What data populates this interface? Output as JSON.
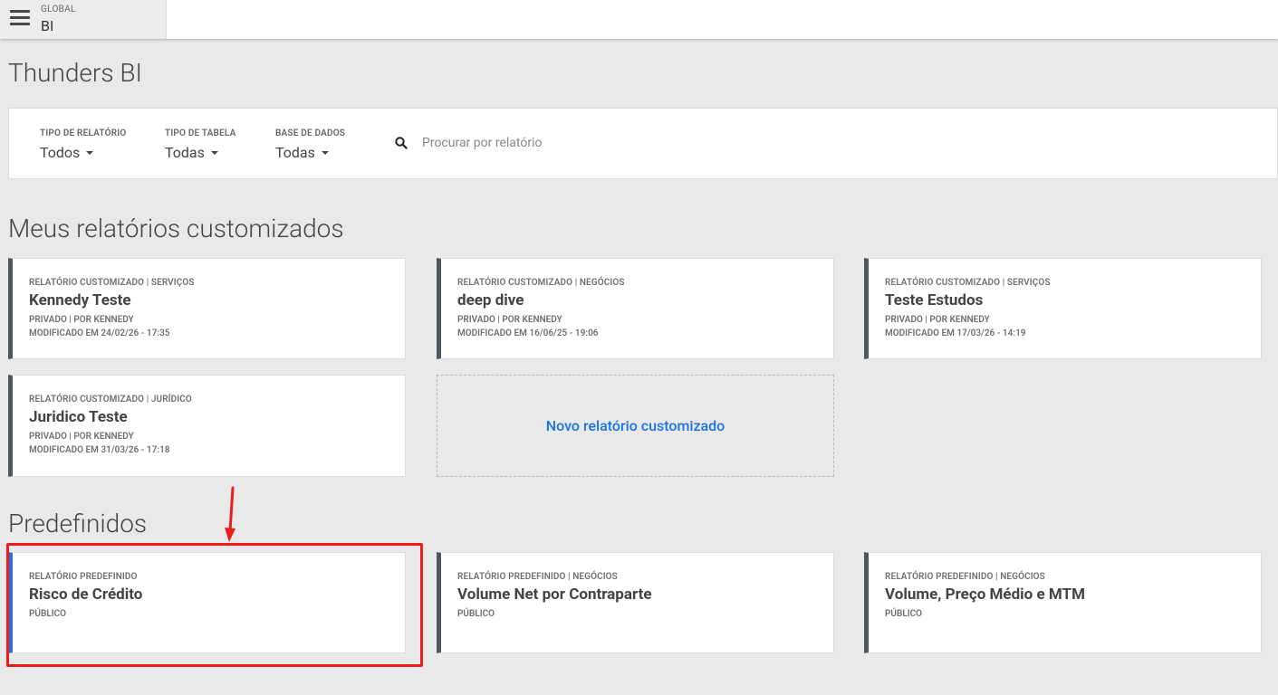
{
  "header": {
    "context_label": "GLOBAL",
    "context_value": "BI"
  },
  "page_title": "Thunders BI",
  "filters": [
    {
      "label": "TIPO DE RELATÓRIO",
      "value": "Todos"
    },
    {
      "label": "TIPO DE TABELA",
      "value": "Todas"
    },
    {
      "label": "BASE DE DADOS",
      "value": "Todas"
    }
  ],
  "search": {
    "placeholder": "Procurar por relatório",
    "value": ""
  },
  "custom_section": {
    "title": "Meus relatórios customizados",
    "cards": [
      {
        "kicker": "RELATÓRIO CUSTOMIZADO | SERVIÇOS",
        "title": "Kennedy Teste",
        "meta1": "PRIVADO | POR KENNEDY",
        "meta2": "MODIFICADO EM 24/02/26 - 17:35"
      },
      {
        "kicker": "RELATÓRIO CUSTOMIZADO | NEGÓCIOS",
        "title": "deep dive",
        "meta1": "PRIVADO | POR KENNEDY",
        "meta2": "MODIFICADO EM 16/06/25 - 19:06"
      },
      {
        "kicker": "RELATÓRIO CUSTOMIZADO | SERVIÇOS",
        "title": "Teste Estudos",
        "meta1": "PRIVADO | POR KENNEDY",
        "meta2": "MODIFICADO EM 17/03/26 - 14:19"
      },
      {
        "kicker": "RELATÓRIO CUSTOMIZADO | JURÍDICO",
        "title": "Juridico Teste",
        "meta1": "PRIVADO | POR KENNEDY",
        "meta2": "MODIFICADO EM 31/03/26 - 17:18"
      }
    ],
    "new_card_label": "Novo relatório customizado"
  },
  "predefined_section": {
    "title": "Predefinidos",
    "cards": [
      {
        "kicker": "RELATÓRIO PREDEFINIDO",
        "title": "Risco de Crédito",
        "meta1": "PÚBLICO"
      },
      {
        "kicker": "RELATÓRIO PREDEFINIDO | NEGÓCIOS",
        "title": "Volume Net por Contraparte",
        "meta1": "PÚBLICO"
      },
      {
        "kicker": "RELATÓRIO PREDEFINIDO | NEGÓCIOS",
        "title": "Volume, Preço Médio e MTM",
        "meta1": "PÚBLICO"
      }
    ]
  },
  "colors": {
    "accent_link": "#1a73e8",
    "card_stripe": "#4a5862",
    "selected_stripe": "#2f6bd6",
    "annotation_red": "#ee1c1c"
  }
}
